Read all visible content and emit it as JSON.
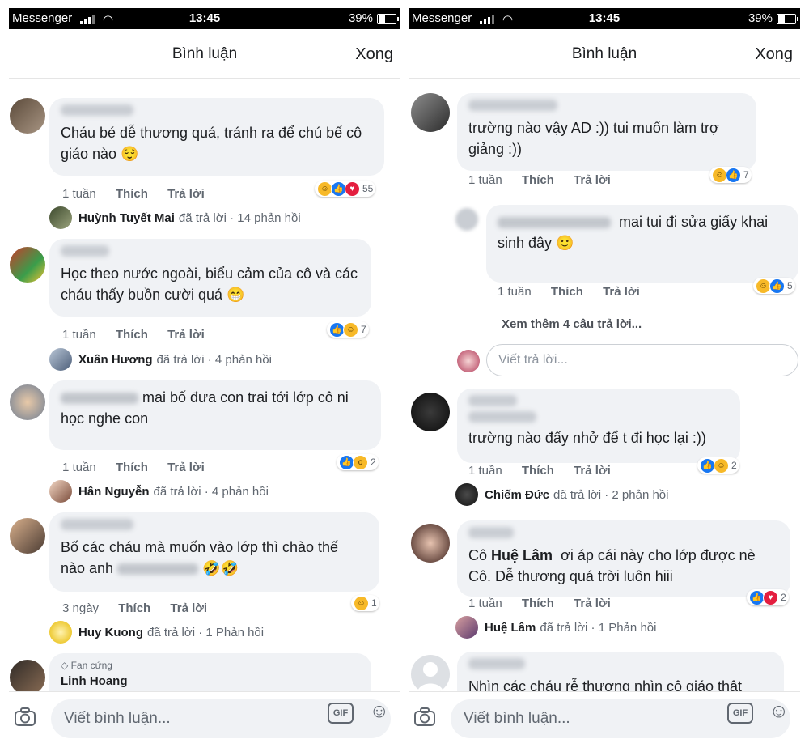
{
  "status": {
    "app": "Messenger",
    "time": "13:45",
    "battery": "39%"
  },
  "header": {
    "title": "Bình luận",
    "done": "Xong"
  },
  "composer": {
    "placeholder": "Viết bình luận...",
    "gif": "GIF"
  },
  "actions": {
    "like": "Thích",
    "reply": "Trả lời",
    "replied": "đã trả lời"
  },
  "left": {
    "comments": [
      {
        "text": "Cháu bé dễ thương quá, tránh ra để chú bế cô giáo nào 😌",
        "time": "1 tuần",
        "count": "55",
        "replier": "Huỳnh Tuyết Mai",
        "replies": "14 phản hồi"
      },
      {
        "text": "Học theo nước ngoài, biểu cảm của cô và các cháu thấy buồn cười quá 😁",
        "time": "1 tuần",
        "count": "7",
        "replier": "Xuân Hương",
        "replies": "4 phản hồi"
      },
      {
        "text_a": "mai bố đưa con trai tới lớp cô ni",
        "text_b": "học nghe con",
        "time": "1 tuần",
        "count": "2",
        "replier": "Hân Nguyễn",
        "replies": "4 phản hồi"
      },
      {
        "text_a": "Bố các cháu mà muốn vào lớp thì chào thế",
        "text_b": "nào anh",
        "text_c": "🤣🤣",
        "time": "3 ngày",
        "count": "1",
        "replier": "Huy Kuong",
        "replies": "1 Phản hồi"
      },
      {
        "badge": "Fan cứng",
        "name": "Linh Hoang"
      }
    ]
  },
  "right": {
    "comments": [
      {
        "text": "trường nào vậy AD :)) tui muốn làm trợ giảng :))",
        "time": "1 tuần",
        "count": "7"
      },
      {
        "text_a": "mai tui đi sửa giấy khai",
        "text_b": "sinh đây 🙂",
        "time": "1 tuần",
        "count": "5"
      },
      {
        "text": "trường nào đấy nhở để t đi học lại :))",
        "time": "1 tuần",
        "count": "2",
        "replier": "Chiếm Đức",
        "replies": "2 phản hồi"
      },
      {
        "text_a": "Cô",
        "mention": "Huệ Lâm",
        "text_b": "ơi áp cái này cho lớp được nè Cô. Dễ thương quá trời luôn hiii",
        "time": "1 tuần",
        "count": "2",
        "replier": "Huệ Lâm",
        "replies": "1 Phản hồi"
      },
      {
        "text": "Nhìn các cháu rễ thương  nhìn cô giáo thật"
      }
    ],
    "more_replies": "Xem thêm 4 câu trả lời...",
    "reply_placeholder": "Viết trả lời..."
  }
}
